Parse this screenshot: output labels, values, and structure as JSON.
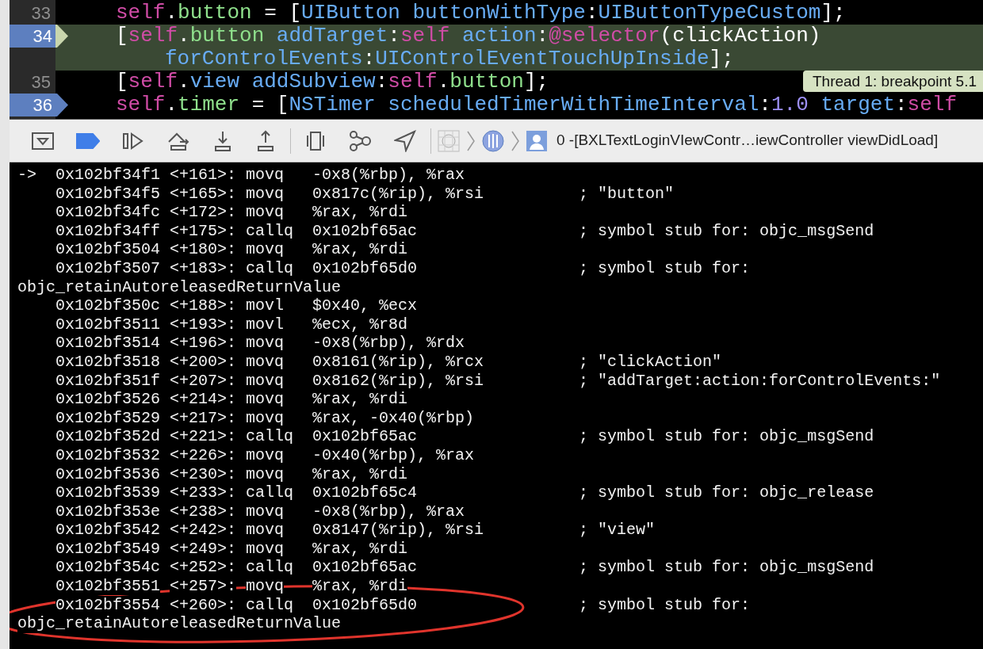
{
  "editor": {
    "lines": [
      {
        "number": "33",
        "breakpoint": false,
        "current": false,
        "tokens": [
          {
            "t": "self",
            "kind": "keyword"
          },
          {
            "t": ".",
            "kind": "plain"
          },
          {
            "t": "button",
            "kind": "property"
          },
          {
            "t": " = [",
            "kind": "plain"
          },
          {
            "t": "UIButton",
            "kind": "name"
          },
          {
            "t": "buttonWithType",
            "kind": "name",
            "space_before": true
          },
          {
            "t": ":",
            "kind": "plain"
          },
          {
            "t": "UIButtonTypeCustom",
            "kind": "name"
          },
          {
            "t": "];",
            "kind": "plain"
          }
        ]
      },
      {
        "number": "34",
        "breakpoint": true,
        "current": true,
        "tokens": [
          {
            "t": "[",
            "kind": "plain"
          },
          {
            "t": "self",
            "kind": "keyword"
          },
          {
            "t": ".",
            "kind": "plain"
          },
          {
            "t": "button",
            "kind": "property"
          },
          {
            "t": "addTarget",
            "kind": "name",
            "space_before": true
          },
          {
            "t": ":",
            "kind": "plain"
          },
          {
            "t": "self",
            "kind": "keyword"
          },
          {
            "t": "action",
            "kind": "name",
            "space_before": true
          },
          {
            "t": ":",
            "kind": "plain"
          },
          {
            "t": "@selector",
            "kind": "keyword"
          },
          {
            "t": "(clickAction)",
            "kind": "plain"
          }
        ],
        "wrapped": [
          {
            "t": "forControlEvents",
            "kind": "name"
          },
          {
            "t": ":",
            "kind": "plain"
          },
          {
            "t": "UIControlEventTouchUpInside",
            "kind": "name"
          },
          {
            "t": "];",
            "kind": "plain"
          }
        ]
      },
      {
        "number": "35",
        "breakpoint": false,
        "current": false,
        "tokens": [
          {
            "t": "[",
            "kind": "plain"
          },
          {
            "t": "self",
            "kind": "keyword"
          },
          {
            "t": ".",
            "kind": "plain"
          },
          {
            "t": "view",
            "kind": "name"
          },
          {
            "t": "addSubview",
            "kind": "name",
            "space_before": true
          },
          {
            "t": ":",
            "kind": "plain"
          },
          {
            "t": "self",
            "kind": "keyword"
          },
          {
            "t": ".",
            "kind": "plain"
          },
          {
            "t": "button",
            "kind": "property"
          },
          {
            "t": "];",
            "kind": "plain"
          }
        ]
      },
      {
        "number": "36",
        "breakpoint": true,
        "current": false,
        "tokens": [
          {
            "t": "self",
            "kind": "keyword"
          },
          {
            "t": ".",
            "kind": "plain"
          },
          {
            "t": "timer",
            "kind": "property"
          },
          {
            "t": " = [",
            "kind": "plain"
          },
          {
            "t": "NSTimer",
            "kind": "name"
          },
          {
            "t": "scheduledTimerWithTimeInterval",
            "kind": "name",
            "space_before": true
          },
          {
            "t": ":",
            "kind": "plain"
          },
          {
            "t": "1.0",
            "kind": "number"
          },
          {
            "t": "target",
            "kind": "name",
            "space_before": true
          },
          {
            "t": ":",
            "kind": "plain"
          },
          {
            "t": "self",
            "kind": "keyword"
          }
        ]
      }
    ],
    "tooltip": "Thread 1: breakpoint 5.1"
  },
  "toolbar": {
    "breakpoints_active": true,
    "frame_label": "0 -[BXLTextLoginVIewContr…iewController viewDidLoad]"
  },
  "disassembly": [
    {
      "kind": "instruction",
      "marker": "->",
      "address": "0x102bf34f1",
      "offset": "<+161>:",
      "mnemonic": "movq",
      "operands": "-0x8(%rbp), %rax"
    },
    {
      "kind": "instruction",
      "address": "0x102bf34f5",
      "offset": "<+165>:",
      "mnemonic": "movq",
      "operands": "0x817c(%rip), %rsi",
      "comment": "; \"button\""
    },
    {
      "kind": "instruction",
      "address": "0x102bf34fc",
      "offset": "<+172>:",
      "mnemonic": "movq",
      "operands": "%rax, %rdi"
    },
    {
      "kind": "instruction",
      "address": "0x102bf34ff",
      "offset": "<+175>:",
      "mnemonic": "callq",
      "operands": "0x102bf65ac",
      "comment": "; symbol stub for: objc_msgSend"
    },
    {
      "kind": "instruction",
      "address": "0x102bf3504",
      "offset": "<+180>:",
      "mnemonic": "movq",
      "operands": "%rax, %rdi"
    },
    {
      "kind": "instruction",
      "address": "0x102bf3507",
      "offset": "<+183>:",
      "mnemonic": "callq",
      "operands": "0x102bf65d0",
      "comment": "; symbol stub for:"
    },
    {
      "kind": "continuation",
      "text": "objc_retainAutoreleasedReturnValue"
    },
    {
      "kind": "instruction",
      "address": "0x102bf350c",
      "offset": "<+188>:",
      "mnemonic": "movl",
      "operands": "$0x40, %ecx"
    },
    {
      "kind": "instruction",
      "address": "0x102bf3511",
      "offset": "<+193>:",
      "mnemonic": "movl",
      "operands": "%ecx, %r8d"
    },
    {
      "kind": "instruction",
      "address": "0x102bf3514",
      "offset": "<+196>:",
      "mnemonic": "movq",
      "operands": "-0x8(%rbp), %rdx"
    },
    {
      "kind": "instruction",
      "address": "0x102bf3518",
      "offset": "<+200>:",
      "mnemonic": "movq",
      "operands": "0x8161(%rip), %rcx",
      "comment": "; \"clickAction\""
    },
    {
      "kind": "instruction",
      "address": "0x102bf351f",
      "offset": "<+207>:",
      "mnemonic": "movq",
      "operands": "0x8162(%rip), %rsi",
      "comment": "; \"addTarget:action:forControlEvents:\""
    },
    {
      "kind": "instruction",
      "address": "0x102bf3526",
      "offset": "<+214>:",
      "mnemonic": "movq",
      "operands": "%rax, %rdi"
    },
    {
      "kind": "instruction",
      "address": "0x102bf3529",
      "offset": "<+217>:",
      "mnemonic": "movq",
      "operands": "%rax, -0x40(%rbp)"
    },
    {
      "kind": "instruction",
      "address": "0x102bf352d",
      "offset": "<+221>:",
      "mnemonic": "callq",
      "operands": "0x102bf65ac",
      "comment": "; symbol stub for: objc_msgSend"
    },
    {
      "kind": "instruction",
      "address": "0x102bf3532",
      "offset": "<+226>:",
      "mnemonic": "movq",
      "operands": "-0x40(%rbp), %rax"
    },
    {
      "kind": "instruction",
      "address": "0x102bf3536",
      "offset": "<+230>:",
      "mnemonic": "movq",
      "operands": "%rax, %rdi"
    },
    {
      "kind": "instruction",
      "address": "0x102bf3539",
      "offset": "<+233>:",
      "mnemonic": "callq",
      "operands": "0x102bf65c4",
      "comment": "; symbol stub for: objc_release"
    },
    {
      "kind": "instruction",
      "address": "0x102bf353e",
      "offset": "<+238>:",
      "mnemonic": "movq",
      "operands": "-0x8(%rbp), %rax"
    },
    {
      "kind": "instruction",
      "address": "0x102bf3542",
      "offset": "<+242>:",
      "mnemonic": "movq",
      "operands": "0x8147(%rip), %rsi",
      "comment": "; \"view\""
    },
    {
      "kind": "instruction",
      "address": "0x102bf3549",
      "offset": "<+249>:",
      "mnemonic": "movq",
      "operands": "%rax, %rdi"
    },
    {
      "kind": "instruction",
      "address": "0x102bf354c",
      "offset": "<+252>:",
      "mnemonic": "callq",
      "operands": "0x102bf65ac",
      "comment": "; symbol stub for: objc_msgSend"
    },
    {
      "kind": "instruction",
      "address": "0x102bf3551",
      "offset": "<+257>:",
      "mnemonic": "movq",
      "operands": "%rax, %rdi"
    },
    {
      "kind": "instruction",
      "address": "0x102bf3554",
      "offset": "<+260>:",
      "mnemonic": "callq",
      "operands": "0x102bf65d0",
      "comment": "; symbol stub for:"
    },
    {
      "kind": "continuation",
      "text": "objc_retainAutoreleasedReturnValue"
    }
  ]
}
